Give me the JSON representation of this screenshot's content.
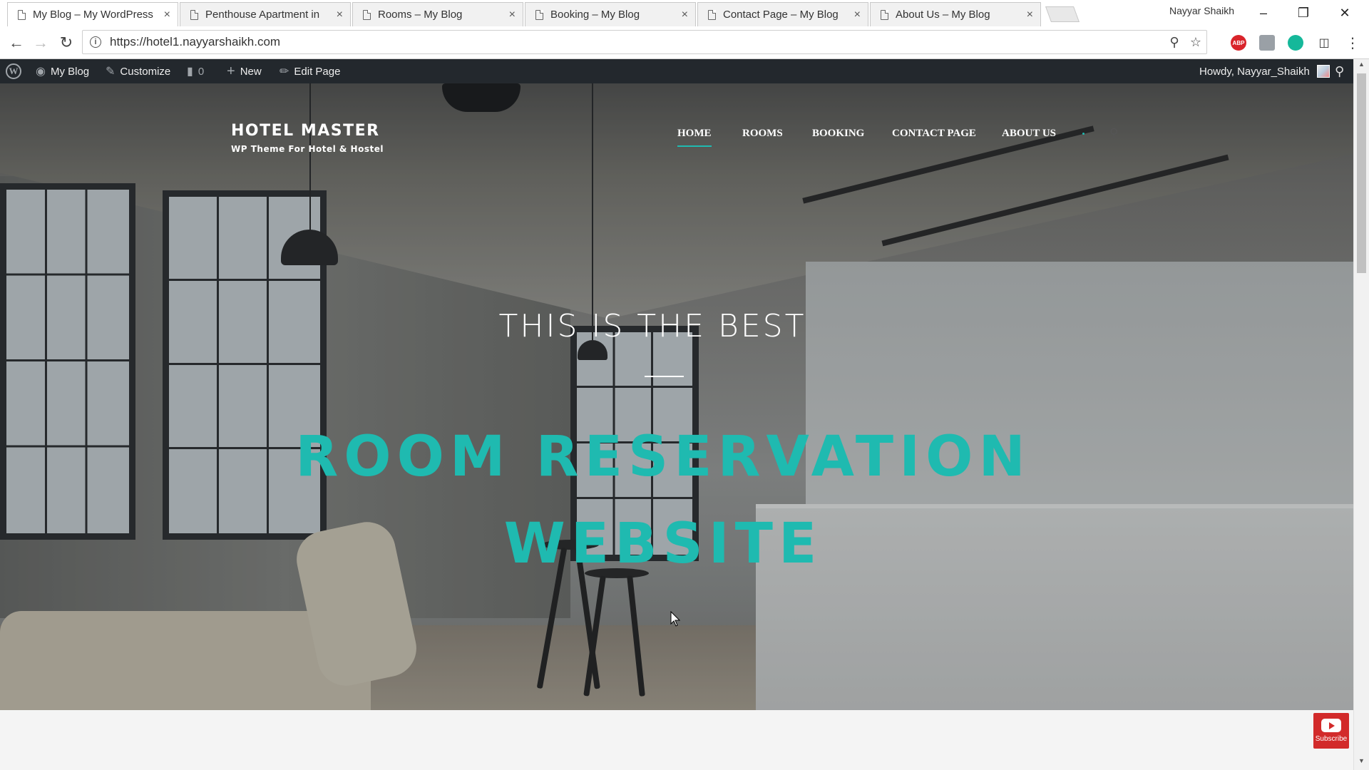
{
  "browser": {
    "tabs": [
      {
        "title": "My Blog – My WordPress",
        "active": true
      },
      {
        "title": "Penthouse Apartment in",
        "active": false
      },
      {
        "title": "Rooms – My Blog",
        "active": false
      },
      {
        "title": "Booking – My Blog",
        "active": false
      },
      {
        "title": "Contact Page – My Blog",
        "active": false
      },
      {
        "title": "About Us – My Blog",
        "active": false
      }
    ],
    "close_glyph": "×",
    "profile_name": "Nayyar Shaikh",
    "url": "https://hotel1.nayyarshaikh.com",
    "extensions": [
      {
        "name": "adblock-plus-icon",
        "label": "ABP",
        "color": "#d9242b"
      },
      {
        "name": "extension-icon",
        "label": "",
        "color": "#9aa0a6"
      },
      {
        "name": "grammarly-icon",
        "label": "",
        "color": "#15b89a"
      },
      {
        "name": "cast-icon",
        "label": "",
        "color": "#333333"
      }
    ]
  },
  "adminbar": {
    "site_name": "My Blog",
    "customize": "Customize",
    "comments_count": "0",
    "new": "New",
    "edit_page": "Edit Page",
    "howdy": "Howdy, Nayyar_Shaikh"
  },
  "site": {
    "title": "HOTEL MASTER",
    "tagline": "WP Theme For Hotel & Hostel",
    "nav": [
      {
        "label": "HOME",
        "current": true
      },
      {
        "label": "ROOMS",
        "current": false
      },
      {
        "label": "BOOKING",
        "current": false
      },
      {
        "label": "CONTACT PAGE",
        "current": false
      },
      {
        "label": "ABOUT US",
        "current": false
      }
    ],
    "accent_color": "#1fbab0"
  },
  "hero": {
    "kicker": "THIS IS THE BEST",
    "headline_line1": "ROOM RESERVATION",
    "headline_line2": "WEBSITE"
  },
  "subscribe": {
    "label": "Subscribe"
  }
}
